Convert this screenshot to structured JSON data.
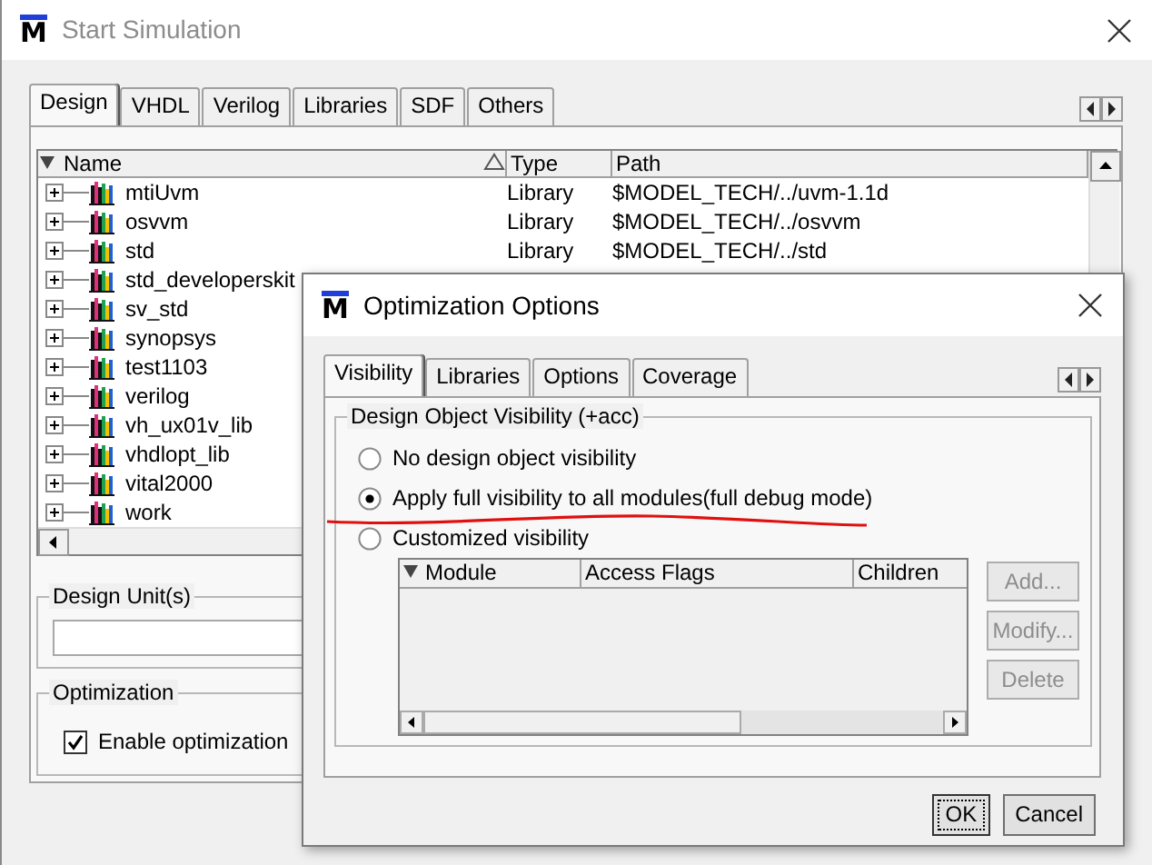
{
  "main_window": {
    "logo": "M",
    "title": "Start Simulation",
    "tabs": [
      {
        "label": "Design",
        "selected": true
      },
      {
        "label": "VHDL",
        "selected": false
      },
      {
        "label": "Verilog",
        "selected": false
      },
      {
        "label": "Libraries",
        "selected": false
      },
      {
        "label": "SDF",
        "selected": false
      },
      {
        "label": "Others",
        "selected": false
      }
    ],
    "table": {
      "columns": [
        "Name",
        "Type",
        "Path"
      ],
      "rows": [
        {
          "name": "mtiUvm",
          "type": "Library",
          "path": "$MODEL_TECH/../uvm-1.1d",
          "expanded": false
        },
        {
          "name": "osvvm",
          "type": "Library",
          "path": "$MODEL_TECH/../osvvm",
          "expanded": false
        },
        {
          "name": "std",
          "type": "Library",
          "path": "$MODEL_TECH/../std",
          "expanded": false
        },
        {
          "name": "std_developerskit",
          "expanded": false
        },
        {
          "name": "sv_std",
          "expanded": false
        },
        {
          "name": "synopsys",
          "expanded": false
        },
        {
          "name": "test1103",
          "expanded": false
        },
        {
          "name": "verilog",
          "expanded": false
        },
        {
          "name": "vh_ux01v_lib",
          "expanded": false
        },
        {
          "name": "vhdlopt_lib",
          "expanded": false
        },
        {
          "name": "vital2000",
          "expanded": false
        },
        {
          "name": "work",
          "expanded": false
        }
      ]
    },
    "design_units": {
      "label": "Design Unit(s)"
    },
    "optimization": {
      "label": "Optimization",
      "checkbox": {
        "label": "Enable optimization",
        "checked": true
      }
    }
  },
  "dialog": {
    "logo": "M",
    "title": "Optimization Options",
    "tabs": [
      {
        "label": "Visibility",
        "selected": true
      },
      {
        "label": "Libraries",
        "selected": false
      },
      {
        "label": "Options",
        "selected": false
      },
      {
        "label": "Coverage",
        "selected": false
      }
    ],
    "group_label": "Design Object Visibility (+acc)",
    "options": [
      {
        "label": "No design object visibility",
        "selected": false
      },
      {
        "label": "Apply full visibility to all modules(full debug mode)",
        "selected": true
      },
      {
        "label": "Customized visibility",
        "selected": false
      }
    ],
    "table": {
      "columns": [
        "Module",
        "Access Flags",
        "Children"
      ]
    },
    "side_buttons": [
      {
        "label": "Add...",
        "disabled": true
      },
      {
        "label": "Modify...",
        "disabled": true
      },
      {
        "label": "Delete",
        "disabled": true
      }
    ],
    "buttons": [
      {
        "label": "OK",
        "disabled": false,
        "default": true
      },
      {
        "label": "Cancel",
        "disabled": false,
        "default": false
      }
    ]
  }
}
